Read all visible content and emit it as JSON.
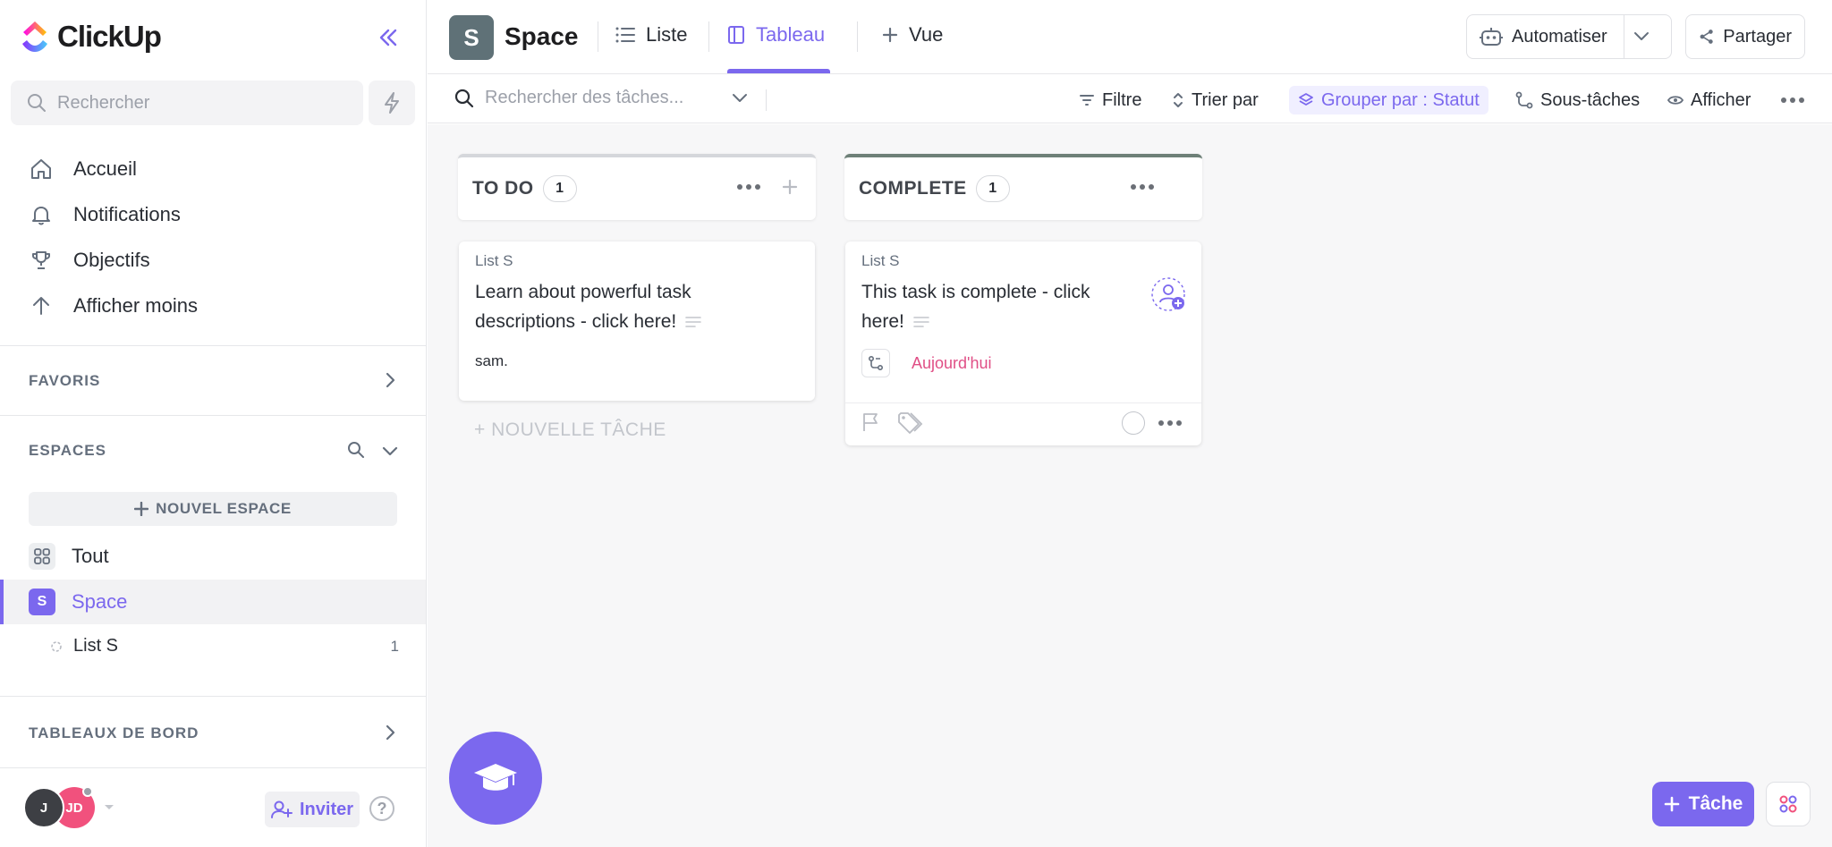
{
  "app": {
    "name": "ClickUp"
  },
  "sidebar": {
    "search_placeholder": "Rechercher",
    "nav": [
      {
        "label": "Accueil",
        "icon": "home-icon"
      },
      {
        "label": "Notifications",
        "icon": "bell-icon"
      },
      {
        "label": "Objectifs",
        "icon": "trophy-icon"
      },
      {
        "label": "Afficher moins",
        "icon": "arrow-up-icon"
      }
    ],
    "favorites_title": "FAVORIS",
    "spaces_title": "ESPACES",
    "new_space_label": "NOUVEL ESPACE",
    "spaces": [
      {
        "label": "Tout",
        "icon": "grid-icon"
      },
      {
        "label": "Space",
        "badge": "S",
        "active": true
      }
    ],
    "list": {
      "label": "List S",
      "count": "1"
    },
    "dashboards_title": "TABLEAUX DE BORD",
    "users": [
      {
        "initials": "J",
        "color": "#3d3f44"
      },
      {
        "initials": "JD",
        "color": "#f1517d"
      }
    ],
    "invite_label": "Inviter",
    "help_label": "?"
  },
  "header": {
    "space_badge": "S",
    "space_name": "Space",
    "tabs": [
      {
        "label": "Liste",
        "icon": "list-icon"
      },
      {
        "label": "Tableau",
        "icon": "board-icon",
        "active": true
      },
      {
        "label": "Vue",
        "icon": "plus-icon"
      }
    ],
    "automate_label": "Automatiser",
    "share_label": "Partager"
  },
  "toolbar": {
    "search_placeholder": "Rechercher des tâches...",
    "filter_label": "Filtre",
    "sort_label": "Trier par",
    "group_label": "Grouper par : Statut",
    "subtasks_label": "Sous-tâches",
    "show_label": "Afficher"
  },
  "board": {
    "columns": [
      {
        "name": "TO DO",
        "count": "1",
        "cards": [
          {
            "list": "List S",
            "title": "Learn about powerful task descriptions - click here!",
            "extra": "sam."
          }
        ],
        "new_task_label": "+ NOUVELLE TÂCHE"
      },
      {
        "name": "COMPLETE",
        "count": "1",
        "cards": [
          {
            "list": "List S",
            "title": "This task is complete - click here!",
            "due": "Aujourd'hui"
          }
        ]
      }
    ]
  },
  "fab": {
    "task_label": "Tâche"
  },
  "colors": {
    "accent": "#7b68ee",
    "space": "#5f7177",
    "due": "#e04f86"
  }
}
